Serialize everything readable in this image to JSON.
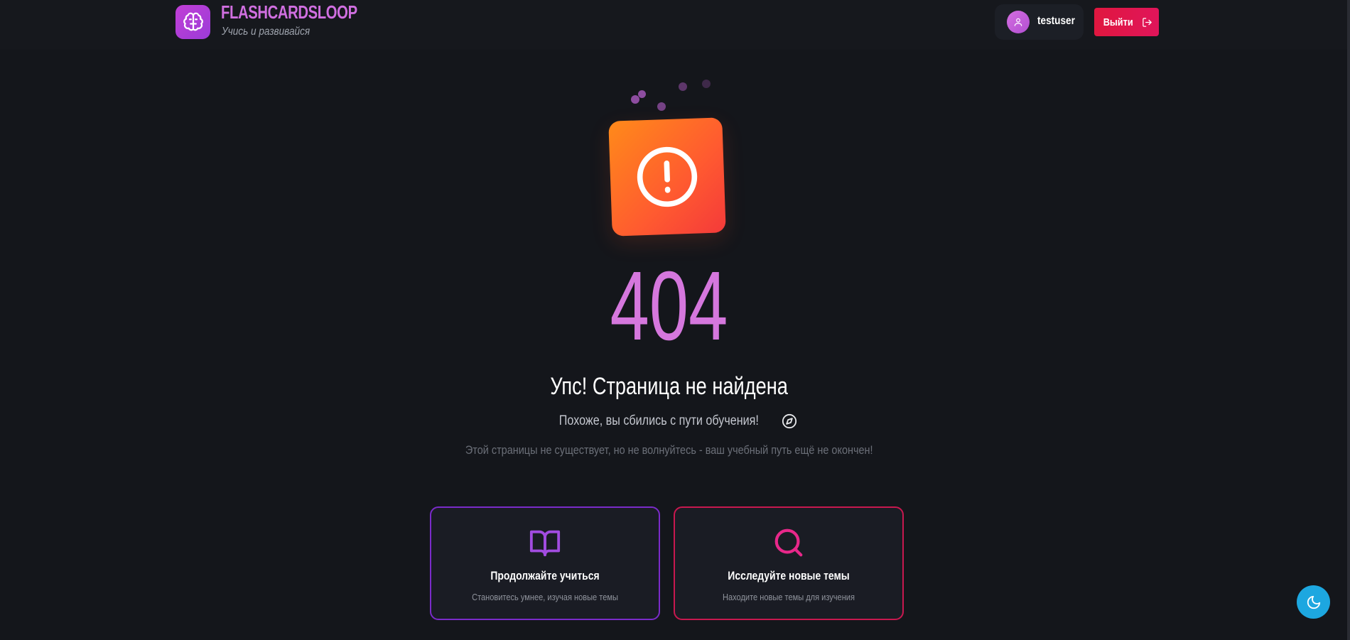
{
  "header": {
    "brand_title": "FLASHCARDSLOOP",
    "brand_subtitle": "Учись и развивайся",
    "user_name": "testuser",
    "logout_label": "Выйти"
  },
  "error": {
    "code": "404",
    "heading": "Упс! Страница не найдена",
    "subline": "Похоже, вы сбились с пути обучения!",
    "note": "Этой страницы не существует, но не волнуйтесь - ваш учебный путь ещё не окончен!"
  },
  "cards": [
    {
      "title": "Продолжайте учиться",
      "description": "Становитесь умнее, изучая новые темы",
      "icon": "book-open-icon",
      "accent": "#a24ce0"
    },
    {
      "title": "Исследуйте новые темы",
      "description": "Находите новые темы для изучения",
      "icon": "search-icon",
      "accent": "#e8288a"
    }
  ],
  "theme": {
    "background": "#14161b",
    "accent_purple": "#d577dd",
    "accent_red": "#e0173f",
    "warning_gradient": [
      "#ff8a1a",
      "#f43a3a"
    ],
    "theme_toggle_color": "#1da7e0"
  }
}
